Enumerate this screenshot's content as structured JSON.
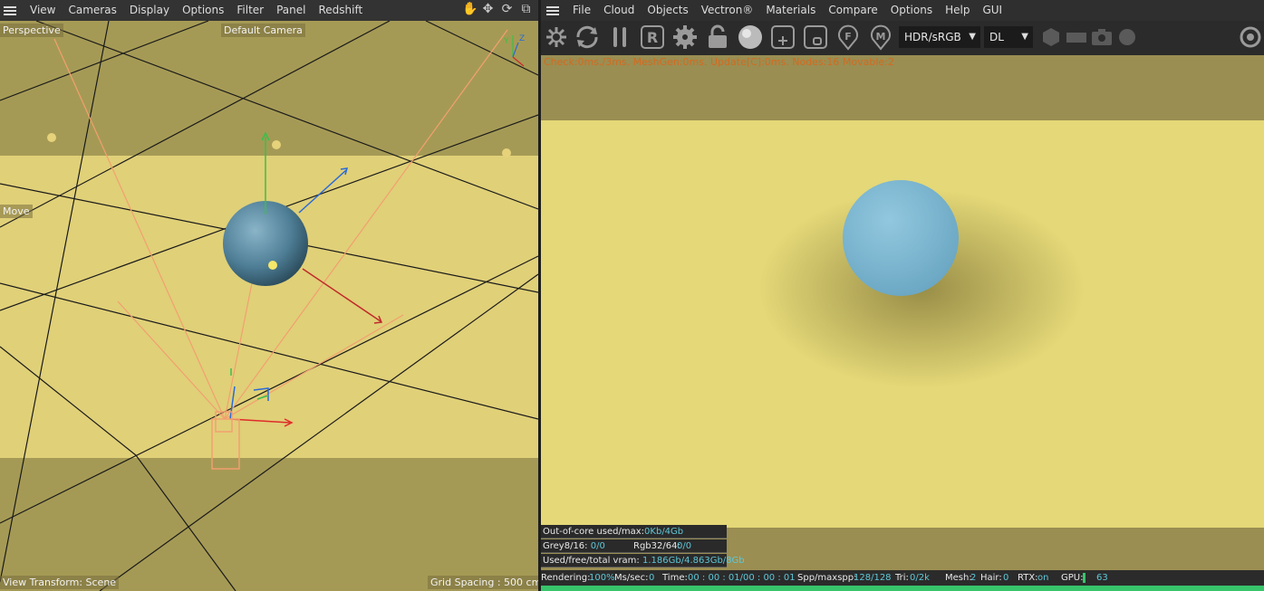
{
  "left": {
    "menu": [
      "View",
      "Cameras",
      "Display",
      "Options",
      "Filter",
      "Panel",
      "Redshift"
    ],
    "icons": [
      "hand-icon",
      "move-icon",
      "rotate-icon",
      "maximize-icon"
    ],
    "labels": {
      "perspective": "Perspective",
      "camera": "Default Camera",
      "tool": "Move",
      "view_transform": "View Transform: Scene",
      "grid_spacing": "Grid Spacing : 500 cm"
    },
    "axis": {
      "y": "Y",
      "z": "Z"
    },
    "colors": {
      "floor": "#e4d47a",
      "background": "#a59a55",
      "sphere": "#5b8aa4"
    }
  },
  "right": {
    "menu": [
      "File",
      "Cloud",
      "Objects",
      "Vectron®",
      "Materials",
      "Compare",
      "Options",
      "Help",
      "GUI"
    ],
    "toolbar": {
      "icons": [
        "octane-icon",
        "refresh-icon",
        "pause-icon",
        "redshift-r-icon",
        "gear-icon",
        "unlock-icon",
        "sphere-icon",
        "add-region-icon",
        "focus-icon",
        "f-pin-icon",
        "m-pin-icon",
        "hexagon-icon",
        "rectangle-icon",
        "camera-icon",
        "circle-icon",
        "settings-icon"
      ],
      "color_space": "HDR/sRGB",
      "kernel": "DL"
    },
    "stats_line": "Check:0ms./3ms. MeshGen:0ms. Update[C]:0ms. Nodes:16 Movable:2",
    "info": {
      "out_of_core_label": "Out-of-core used/max:",
      "out_of_core_value": "0Kb/4Gb",
      "grey_label": "Grey8/16:",
      "grey_value": "0/0",
      "rgb_label": "Rgb32/64:",
      "rgb_value": "0/0",
      "vram_label": "Used/free/total vram:",
      "vram_value": "1.186Gb/4.863Gb/8Gb"
    },
    "status": {
      "rendering_label": "Rendering:",
      "rendering_value": "100%",
      "ms_label": "Ms/sec:",
      "ms_value": "0",
      "time_label": "Time:",
      "time_value": "00 : 00 : 01/00 : 00 : 01",
      "spp_label": "Spp/maxspp:",
      "spp_value": "128/128",
      "tri_label": "Tri:",
      "tri_value": "0/2k",
      "mesh_label": "Mesh:",
      "mesh_value": "2",
      "hair_label": "Hair:",
      "hair_value": "0",
      "rtx_label": "RTX:",
      "rtx_value": "on",
      "gpu_label": "GPU:",
      "gpu_value": "63"
    },
    "progress": 1.0,
    "colors": {
      "floor": "#e4d878",
      "sphere": "#86bfd8",
      "progress": "#38c46a"
    }
  }
}
